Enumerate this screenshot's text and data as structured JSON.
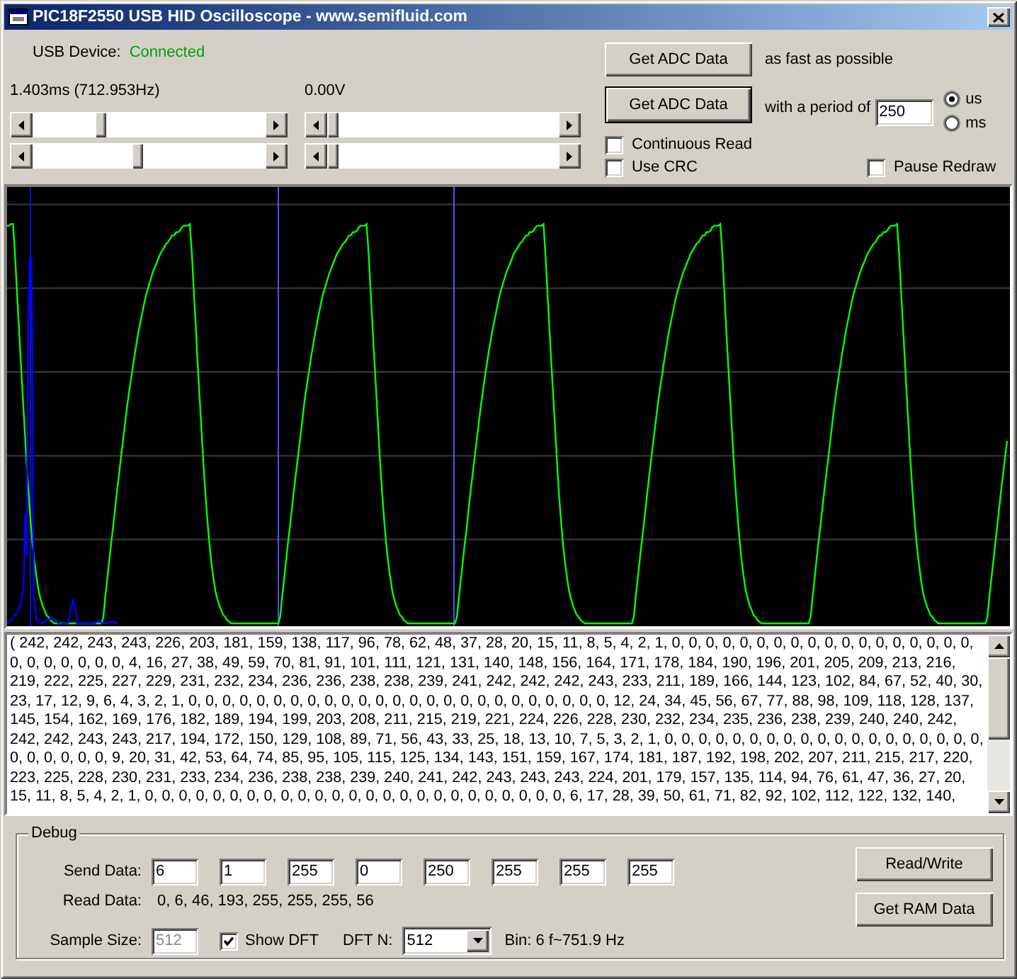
{
  "window": {
    "title": "PIC18F2550 USB HID Oscilloscope - www.semifluid.com"
  },
  "usb_device": {
    "label": "USB Device:",
    "status": "Connected",
    "connected": true
  },
  "time_controls": {
    "reading": "1.403ms (712.953Hz)",
    "sliders": [
      {
        "level": 0.28
      },
      {
        "level": 0.45
      }
    ]
  },
  "voltage_controls": {
    "reading": "0.00V",
    "sliders": [
      {
        "level": 0
      },
      {
        "level": 0
      }
    ]
  },
  "acquisition": {
    "buttons": [
      {
        "label": "Get ADC Data",
        "default": false,
        "note": "as fast as possible"
      },
      {
        "label": "Get ADC Data",
        "default": true,
        "note": "with a period of"
      }
    ],
    "period": {
      "value": "250"
    },
    "units": [
      {
        "label": "us",
        "selected": true
      },
      {
        "label": "ms",
        "selected": false
      }
    ]
  },
  "read_options": [
    {
      "label": "Continuous Read",
      "checked": false
    },
    {
      "label": "Use CRC",
      "checked": false
    }
  ],
  "pause_redraw": {
    "label": "Pause Redraw",
    "checked": false
  },
  "sample_text": {
    "lines": [
      "( 242, 242, 243, 243, 226, 203, 181, 159, 138, 117, 96, 78, 62, 48, 37, 28, 20, 15, 11, 8, 5, 4, 2, 1, 0, 0, 0, 0, 0, 0, 0, 0, 0, 0, 0, 0, 0, 0, 0, 0, 0, 0,",
      "0, 0, 0, 0, 0, 0, 0, 4, 16, 27, 38, 49, 59, 70, 81, 91, 101, 111, 121, 131, 140, 148, 156, 164, 171, 178, 184, 190, 196, 201, 205, 209, 213, 216,",
      "219, 222, 225, 227, 229, 231, 232, 234, 236, 236, 238, 238, 239, 241, 242, 242, 242, 243, 233, 211, 189, 166, 144, 123, 102, 84, 67, 52, 40, 30,",
      "23, 17, 12, 9, 6, 4, 3, 2, 1, 0, 0, 0, 0, 0, 0, 0, 0, 0, 0, 0, 0, 0, 0, 0, 0, 0, 0, 0, 0, 0, 0, 0, 0, 0, 12, 24, 34, 45, 56, 67, 77, 88, 98, 109, 118, 128, 137,",
      "145, 154, 162, 169, 176, 182, 189, 194, 199, 203, 208, 211, 215, 219, 221, 224, 226, 228, 230, 232, 234, 235, 236, 238, 239, 240, 240, 242,",
      "242, 242, 243, 243, 217, 194, 172, 150, 129, 108, 89, 71, 56, 43, 33, 25, 18, 13, 10, 7, 5, 3, 2, 1, 0, 0, 0, 0, 0, 0, 0, 0, 0, 0, 0, 0, 0, 0, 0, 0, 0, 0, 0,",
      "0, 0, 0, 0, 0, 0, 9, 20, 31, 42, 53, 64, 74, 85, 95, 105, 115, 125, 134, 143, 151, 159, 167, 174, 181, 187, 192, 198, 202, 207, 211, 215, 217, 220,",
      "223, 225, 228, 230, 231, 233, 234, 236, 238, 238, 239, 240, 241, 242, 243, 243, 243, 224, 201, 179, 157, 135, 114, 94, 76, 61, 47, 36, 27, 20,",
      "15, 11, 8, 5, 4, 2, 1, 0, 0, 0, 0, 0, 0, 0, 0, 0, 0, 0, 0, 0, 0, 0, 0, 0, 0, 0, 0, 0, 0, 0, 0, 0, 6, 17, 28, 39, 50, 61, 71, 82, 92, 102, 112, 122, 132, 140,"
    ]
  },
  "debug": {
    "title": "Debug",
    "send_data": {
      "label": "Send Data:",
      "values": [
        "6",
        "1",
        "255",
        "0",
        "250",
        "255",
        "255",
        "255"
      ]
    },
    "read_data": {
      "label": "Read Data:",
      "value": "0, 6, 46, 193, 255, 255, 255, 56"
    },
    "sample_size": {
      "label": "Sample Size:",
      "value": "512",
      "disabled": true
    },
    "show_dft": {
      "label": "Show DFT",
      "checked": true
    },
    "dft_n": {
      "label": "DFT N:",
      "value": "512"
    },
    "bin": "Bin: 6 f~751.9 Hz",
    "buttons": [
      "Read/Write",
      "Get RAM Data"
    ]
  }
}
